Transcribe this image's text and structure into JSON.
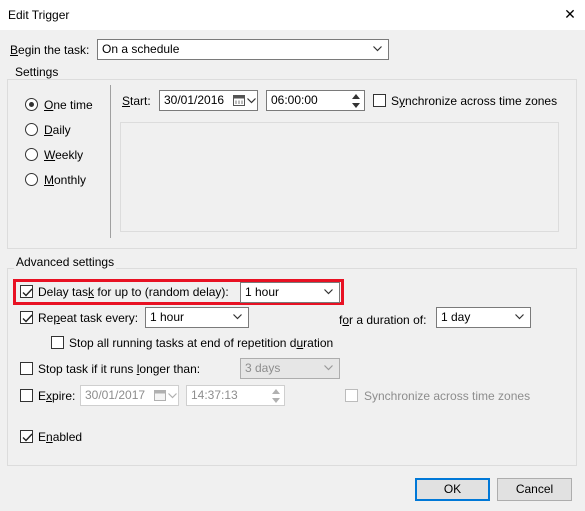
{
  "window": {
    "title": "Edit Trigger"
  },
  "begin_task": {
    "label": "Begin the task:",
    "value": "On a schedule"
  },
  "settings": {
    "group_label": "Settings",
    "radios": [
      {
        "label": "One time",
        "checked": true
      },
      {
        "label": "Daily",
        "checked": false
      },
      {
        "label": "Weekly",
        "checked": false
      },
      {
        "label": "Monthly",
        "checked": false
      }
    ],
    "start_label": "Start:",
    "start_date": "30/01/2016",
    "start_time": "06:00:00",
    "sync_label": "Synchronize across time zones"
  },
  "advanced": {
    "group_label": "Advanced settings",
    "delay": {
      "label": "Delay task for up to (random delay):",
      "value": "1 hour",
      "checked": true
    },
    "repeat": {
      "label": "Repeat task every:",
      "value": "1 hour",
      "checked": true,
      "duration_label": "for a duration of:",
      "duration_value": "1 day"
    },
    "stop_running": {
      "label": "Stop all running tasks at end of repetition duration",
      "checked": false
    },
    "stop_longer": {
      "label": "Stop task if it runs longer than:",
      "value": "3 days",
      "checked": false
    },
    "expire": {
      "label": "Expire:",
      "date": "30/01/2017",
      "time": "14:37:13",
      "sync_label": "Synchronize across time zones",
      "checked": false
    },
    "enabled": {
      "label": "Enabled",
      "checked": true
    }
  },
  "buttons": {
    "ok": "OK",
    "cancel": "Cancel"
  },
  "colors": {
    "highlight": "#e81123",
    "focus_blue": "#0078d7"
  }
}
